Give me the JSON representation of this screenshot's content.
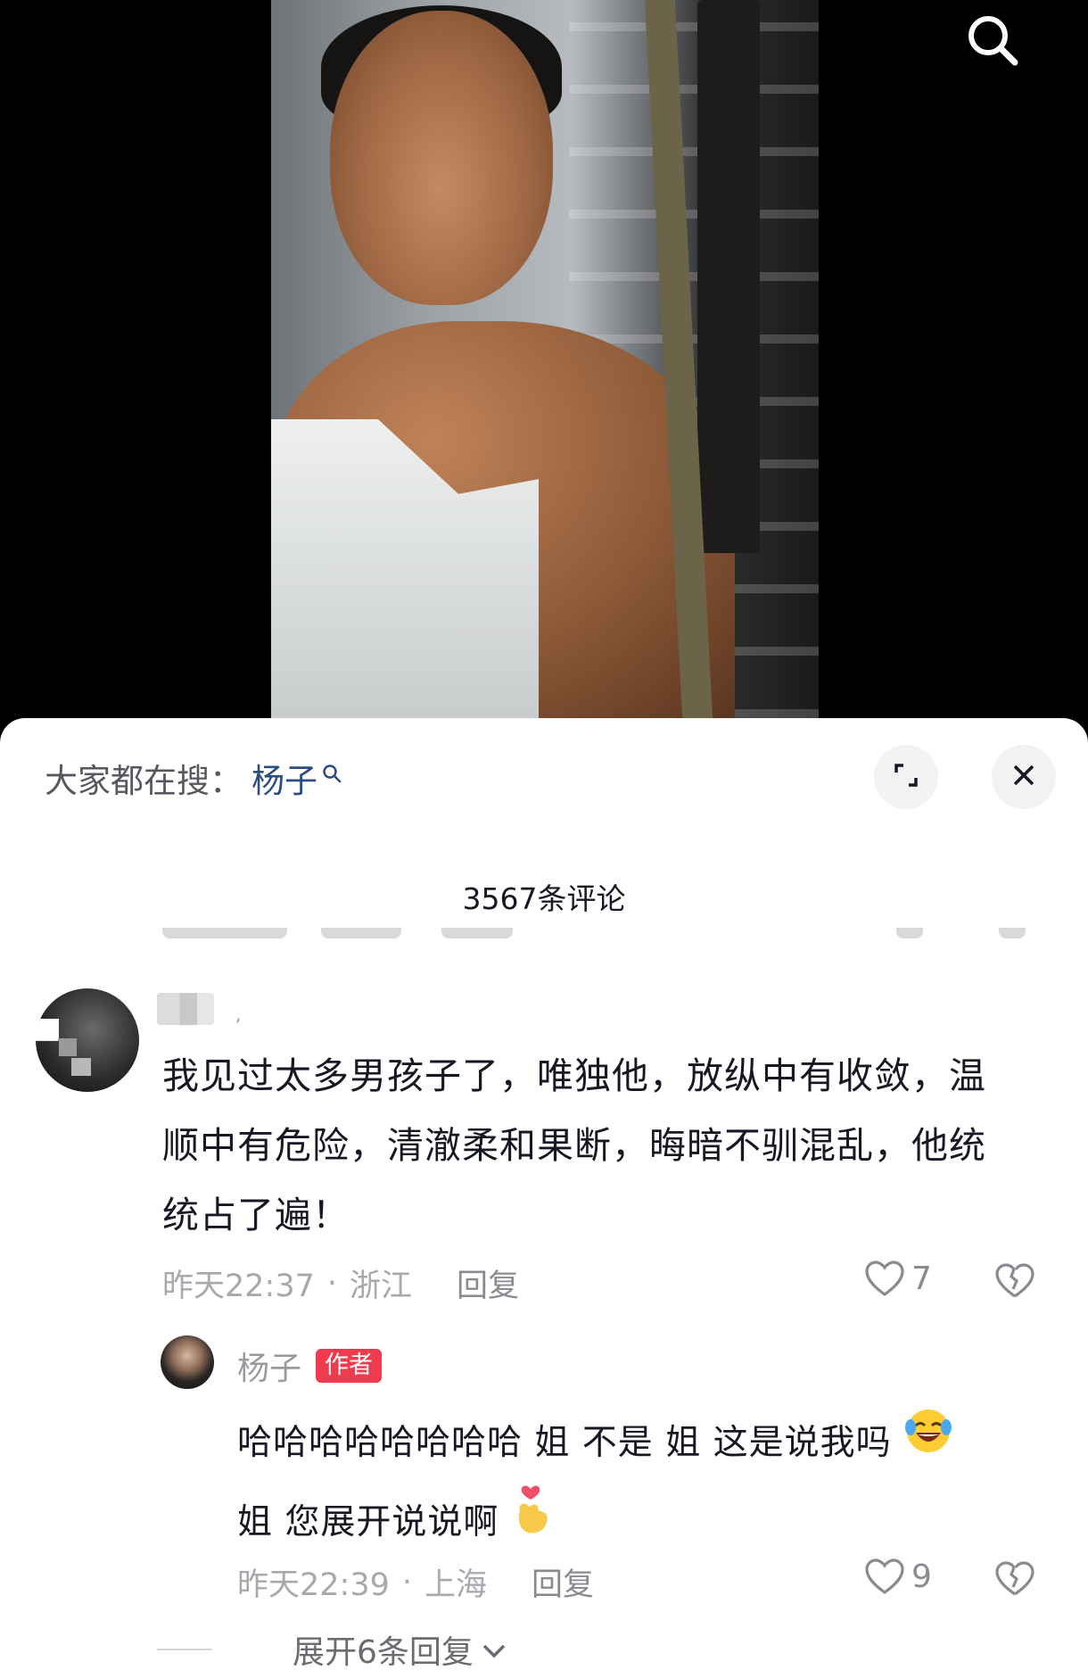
{
  "hot_search": {
    "label": "大家都在搜：",
    "keyword": "杨子"
  },
  "comment_count": "3567条评论",
  "comments": [
    {
      "text": "我见过太多男孩子了，唯独他，放纵中有收敛，温顺中有危险，清澈柔和果断，晦暗不驯混乱，他统统占了遍！",
      "lines": [
        "我见过太多男孩子了，唯独他，放纵中有收敛，温",
        "顺中有危险，清澈柔和果断，晦暗不驯混乱，他统",
        "统占了遍！"
      ],
      "time": "昨天22:37",
      "location": "浙江",
      "reply_label": "回复",
      "likes": "7",
      "replies": [
        {
          "username": "杨子",
          "tag": "作者",
          "line1": "哈哈哈哈哈哈哈哈 姐 不是 姐 这是说我吗",
          "line2": "姐 您展开说说啊",
          "emoji1": "laughing-crying-emoji",
          "emoji2": "finger-heart-emoji",
          "time": "昨天22:39",
          "location": "上海",
          "reply_label": "回复",
          "likes": "9"
        }
      ],
      "expand_label": "展开6条回复"
    }
  ],
  "colors": {
    "author_tag": "#f03a4e",
    "keyword": "#2a4d82",
    "meta": "#a8a9ae"
  }
}
